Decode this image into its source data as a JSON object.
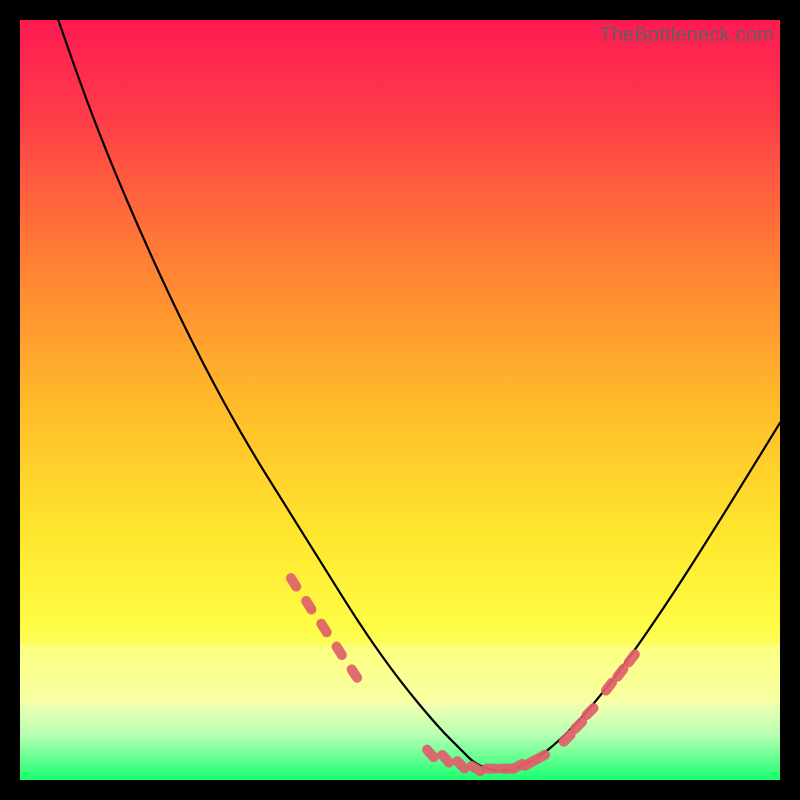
{
  "watermark": "TheBottleneck.com",
  "colors": {
    "bg": "#000000",
    "curve": "#000000",
    "marker": "#e0606a",
    "gradient_top": "#ff1a52",
    "gradient_mid1": "#ff8f2a",
    "gradient_mid2": "#ffe72e",
    "gradient_band": "#f9ff8a",
    "gradient_bottom": "#19ff70"
  },
  "chart_data": {
    "type": "line",
    "title": "",
    "xlabel": "",
    "ylabel": "",
    "xlim": [
      0,
      100
    ],
    "ylim": [
      0,
      100
    ],
    "series": [
      {
        "name": "bottleneck-curve",
        "x": [
          0,
          5,
          10,
          15,
          20,
          25,
          30,
          35,
          40,
          45,
          50,
          55,
          58,
          60,
          63,
          67,
          72,
          78,
          85,
          92,
          100
        ],
        "y": [
          115,
          100,
          86,
          74,
          63,
          53,
          44,
          36,
          28,
          20,
          13,
          7,
          4,
          2,
          1,
          2,
          6,
          13,
          23,
          34,
          47
        ]
      }
    ],
    "markers": [
      {
        "name": "left-cluster",
        "points": [
          [
            36,
            26
          ],
          [
            38,
            23
          ],
          [
            40,
            20
          ],
          [
            42,
            17
          ],
          [
            44,
            14
          ]
        ]
      },
      {
        "name": "trough-cluster",
        "points": [
          [
            54,
            3.5
          ],
          [
            56,
            2.8
          ],
          [
            58,
            2.0
          ],
          [
            60,
            1.5
          ],
          [
            62,
            1.5
          ],
          [
            64,
            1.5
          ],
          [
            65.5,
            1.8
          ],
          [
            67,
            2.2
          ],
          [
            68.5,
            3.0
          ]
        ]
      },
      {
        "name": "right-cluster",
        "points": [
          [
            72,
            5.5
          ],
          [
            73.5,
            7.2
          ],
          [
            75,
            9.0
          ],
          [
            77.5,
            12.3
          ],
          [
            79,
            14.1
          ],
          [
            80.5,
            16.0
          ]
        ]
      }
    ]
  }
}
